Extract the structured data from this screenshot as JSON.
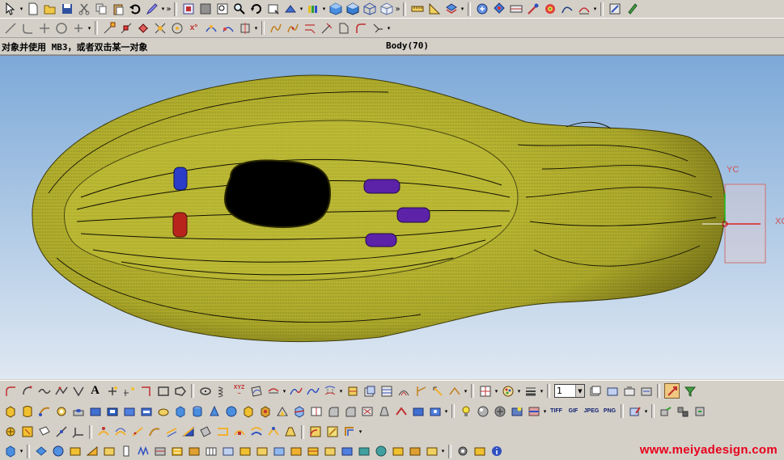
{
  "status": {
    "prompt": "对象并使用 MB3，或者双击某一对象",
    "selection": "Body(70)"
  },
  "viewport": {
    "wcs_y_label": "YC",
    "wcs_x_label": "XC",
    "part_color": "#b7b52b",
    "background_top": "#7da9d8",
    "background_bottom": "#dfe8f2"
  },
  "toolbar_bottom": {
    "layer_value": "1",
    "export_formats": [
      "TIFF",
      "GIF",
      "JPEG",
      "PNG"
    ]
  },
  "watermark": "www.meiyadesign.com",
  "icons": {
    "row1": [
      "select-arrow-icon",
      "new-icon",
      "open-icon",
      "save-icon",
      "cut-icon",
      "copy-icon",
      "paste-icon",
      "undo-icon",
      "edit-icon",
      "fit-icon",
      "zoom-icon",
      "zoom-window-icon",
      "rotate-icon",
      "pan-icon",
      "shaded-icon",
      "wireframe-icon",
      "color-icon",
      "view-iso-icon",
      "view-top-icon",
      "view-front-icon",
      "measure-icon",
      "analysis-icon",
      "layer-icon",
      "move-icon",
      "transform-icon",
      "section-icon",
      "point-icon",
      "surface-icon",
      "curve-icon",
      "feature-icon"
    ],
    "row2": [
      "line-icon",
      "arc-icon",
      "trim-icon",
      "circle-icon",
      "point-set-icon",
      "snap-icon",
      "snap2-icon",
      "snap3-icon",
      "snap4-icon",
      "snap5-icon",
      "snap6-icon",
      "snap7-icon",
      "snap8-icon",
      "snap9-icon",
      "snap10-icon",
      "snap11-icon",
      "snap12-icon",
      "snap13-icon",
      "snap14-icon",
      "snap15-icon"
    ]
  },
  "colors": {
    "bar_bg": "#d4d0c8",
    "blue_boss": "#2a3cc8",
    "red_boss": "#b8241c",
    "purple_boss": "#5c22a8",
    "watermark": "#e8001c"
  }
}
